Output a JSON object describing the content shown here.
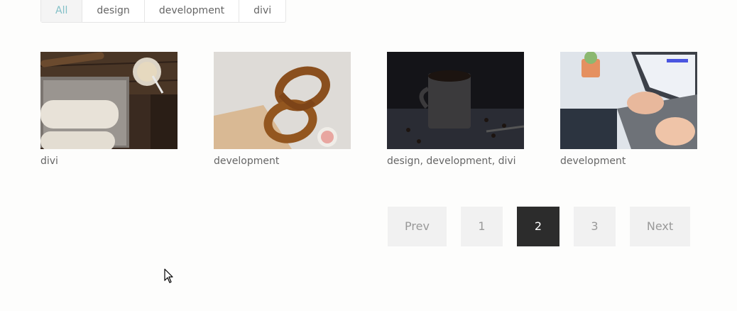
{
  "filters": {
    "tabs": [
      {
        "label": "All",
        "active": true
      },
      {
        "label": "design",
        "active": false
      },
      {
        "label": "development",
        "active": false
      },
      {
        "label": "divi",
        "active": false
      }
    ]
  },
  "colors": {
    "accent": "#82c0c7",
    "current_page_bg": "#2c2c2c",
    "button_bg": "#f1f1f1"
  },
  "portfolio": {
    "items": [
      {
        "category": "divi",
        "image": "dough-baking-tray"
      },
      {
        "category": "development",
        "image": "pretzels"
      },
      {
        "category": "design, development, divi",
        "image": "coffee-beans-mug"
      },
      {
        "category": "development",
        "image": "laptop-typing"
      }
    ]
  },
  "pagination": {
    "prev_label": "Prev",
    "pages": [
      "1",
      "2",
      "3"
    ],
    "current_page": "2",
    "next_label": "Next"
  }
}
